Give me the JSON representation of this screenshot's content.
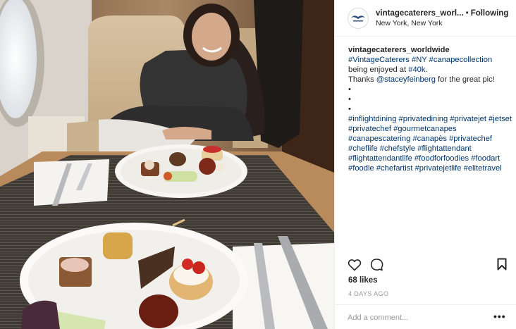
{
  "post": {
    "username": "vintagecaterers_worl...",
    "separator": "•",
    "follow_label": "Following",
    "location": "New York, New York",
    "caption": {
      "author": "vintagecaterers_worldwide",
      "line1_tags": [
        "#VintageCaterers",
        "#NY",
        "#canapecollection"
      ],
      "line1_text": "being enjoyed at",
      "line1_end_tag": "#40k",
      "line1_end": ".",
      "thanks_prefix": "Thanks",
      "thanks_mention": "@staceyfeinberg",
      "thanks_suffix": "for the great pic!",
      "bullets": [
        "•",
        "•",
        "•"
      ],
      "hashtags": [
        "#inflightdining",
        "#privatedining",
        "#privatejet",
        "#jetset",
        "#privatechef",
        "#gourmetcanapes",
        "#canapescatering",
        "#canapès",
        "#privatechef",
        "#cheflife",
        "#chefstyle",
        "#flightattendant",
        "#flightattendantlife",
        "#foodforfoodies",
        "#foodart",
        "#foodie",
        "#chefartist",
        "#privatejetlife",
        "#elitetravel"
      ]
    },
    "likes": "68 likes",
    "timestamp": "4 DAYS AGO",
    "comment_placeholder": "Add a comment...",
    "more_label": "•••"
  },
  "icons": {
    "like": "heart-icon",
    "comment": "comment-bubble-icon",
    "save": "bookmark-icon",
    "avatar": "vintage-caterers-logo"
  },
  "colors": {
    "text": "#262626",
    "hashtag": "#003569",
    "muted": "#999999",
    "divider": "#efefef"
  }
}
